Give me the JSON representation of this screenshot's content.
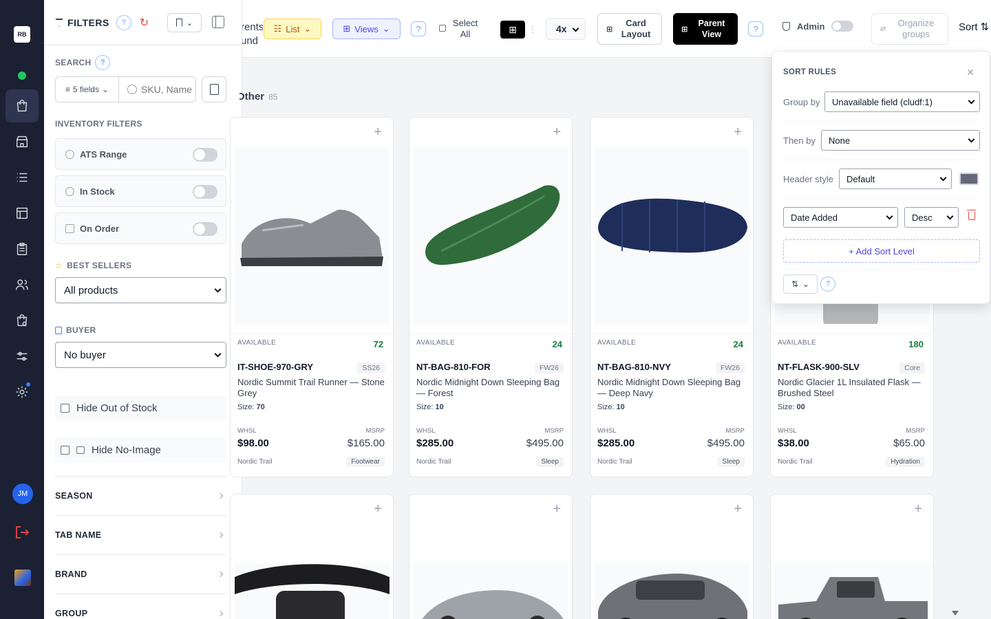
{
  "rail": {
    "logo": "RB",
    "avatar": "JM"
  },
  "filters": {
    "title": "FILTERS",
    "search_label": "SEARCH",
    "fields_btn": "5 fields",
    "search_placeholder": "SKU, Name",
    "inventory_label": "INVENTORY FILTERS",
    "toggles": [
      {
        "label": "ATS Range",
        "on": false
      },
      {
        "label": "In Stock",
        "on": false
      },
      {
        "label": "On Order",
        "on": false
      }
    ],
    "best_sellers_label": "BEST SELLERS",
    "best_sellers_value": "All products",
    "buyer_label": "BUYER",
    "buyer_value": "No buyer",
    "hide_out_of_stock": "Hide Out of Stock",
    "hide_no_image": "Hide No-Image",
    "accordions": [
      "SEASON",
      "TAB NAME",
      "BRAND",
      "GROUP"
    ]
  },
  "toolbar": {
    "cut_text_1": "rents",
    "cut_text_2": "und",
    "list": "List",
    "views": "Views",
    "select_all_1": "Select",
    "select_all_2": "All",
    "columns": "4x",
    "card_layout_1": "Card",
    "card_layout_2": "Layout",
    "parent_view_1": "Parent",
    "parent_view_2": "View",
    "admin": "Admin",
    "organize_1": "Organize",
    "organize_2": "groups",
    "sort": "Sort"
  },
  "group": {
    "name": "Other",
    "count": "85"
  },
  "cards": [
    {
      "available_label": "AVAILABLE",
      "available": "72",
      "sku": "IT-SHOE-970-GRY",
      "season": "SS26",
      "name": "Nordic Summit Trail Runner — Stone Grey",
      "size_label": "Size:",
      "size": "70",
      "whsl_label": "WHSL",
      "whsl": "$98.00",
      "msrp_label": "MSRP",
      "msrp": "$165.00",
      "brand": "Nordic Trail",
      "category": "Footwear",
      "image": "grey trail running shoe"
    },
    {
      "available_label": "AVAILABLE",
      "available": "24",
      "sku": "NT-BAG-810-FOR",
      "season": "FW26",
      "name": "Nordic Midnight Down Sleeping Bag — Forest",
      "size_label": "Size:",
      "size": "10",
      "whsl_label": "WHSL",
      "whsl": "$285.00",
      "msrp_label": "MSRP",
      "msrp": "$495.00",
      "brand": "Nordic Trail",
      "category": "Sleep",
      "image": "green mummy sleeping bag"
    },
    {
      "available_label": "AVAILABLE",
      "available": "24",
      "sku": "NT-BAG-810-NVY",
      "season": "FW26",
      "name": "Nordic Midnight Down Sleeping Bag — Deep Navy",
      "size_label": "Size:",
      "size": "10",
      "whsl_label": "WHSL",
      "whsl": "$285.00",
      "msrp_label": "MSRP",
      "msrp": "$495.00",
      "brand": "Nordic Trail",
      "category": "Sleep",
      "image": "navy sleeping bag"
    },
    {
      "available_label": "AVAILABLE",
      "available": "180",
      "sku": "NT-FLASK-900-SLV",
      "season": "Core",
      "name": "Nordic Glacier 1L Insulated Flask — Brushed Steel",
      "size_label": "Size:",
      "size": "00",
      "whsl_label": "WHSL",
      "whsl": "$38.00",
      "msrp_label": "MSRP",
      "msrp": "$65.00",
      "brand": "Nordic Trail",
      "category": "Hydration",
      "image": "steel flask"
    }
  ],
  "cards_row2": [
    {
      "image": "headlamp"
    },
    {
      "image": "silver sports car"
    },
    {
      "image": "grey suv"
    },
    {
      "image": "grey pickup truck"
    }
  ],
  "sort_panel": {
    "title": "SORT RULES",
    "group_by_label": "Group by",
    "group_by_value": "Unavailable field (cludf:1)",
    "then_by_label": "Then by",
    "then_by_value": "None",
    "header_style_label": "Header style",
    "header_style_value": "Default",
    "header_color": "#64687a",
    "sort_field": "Date Added",
    "sort_dir": "Desc",
    "add_level": "+ Add Sort Level"
  }
}
